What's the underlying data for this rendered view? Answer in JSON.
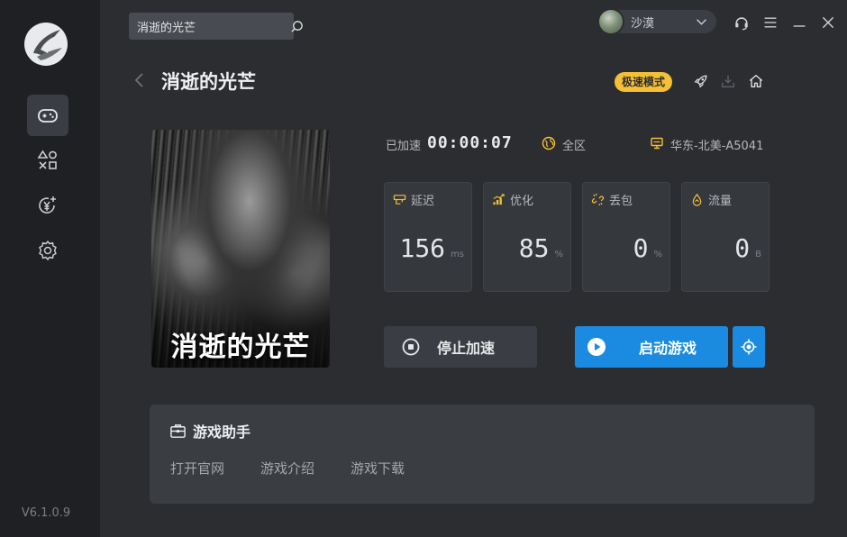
{
  "search": {
    "value": "消逝的光芒",
    "icon": "search-icon"
  },
  "user": {
    "name": "沙漠"
  },
  "topbar_icons": [
    "headset-icon",
    "menu-icon",
    "minimize-icon",
    "close-icon"
  ],
  "sidebar": {
    "items": [
      {
        "name": "games",
        "icon": "gamepad-icon",
        "active": true
      },
      {
        "name": "shapes",
        "icon": "shapes-icon",
        "active": false
      },
      {
        "name": "recharge",
        "icon": "yen-add-icon",
        "active": false
      },
      {
        "name": "settings",
        "icon": "gear-icon",
        "active": false
      }
    ],
    "version": "V6.1.0.9"
  },
  "game": {
    "title": "消逝的光芒",
    "cover_title": "消逝的光芒",
    "mode_badge": "极速模式"
  },
  "status": {
    "accelerated_label": "已加速",
    "timer": "00:00:07",
    "region": "全区",
    "server": "华东-北美-A5041"
  },
  "stats": [
    {
      "label": "延迟",
      "value": "156",
      "unit": "ms",
      "icon": "latency-icon"
    },
    {
      "label": "优化",
      "value": "85",
      "unit": "%",
      "icon": "signal-bars-icon"
    },
    {
      "label": "丢包",
      "value": "0",
      "unit": "%",
      "icon": "broken-link-icon"
    },
    {
      "label": "流量",
      "value": "0",
      "unit": "B",
      "icon": "drop-icon"
    }
  ],
  "buttons": {
    "stop": "停止加速",
    "start": "启动游戏"
  },
  "helper": {
    "title": "游戏助手",
    "links": [
      "打开官网",
      "游戏介绍",
      "游戏下载"
    ]
  },
  "colors": {
    "accent_blue": "#1a8be0",
    "badge_yellow": "#f5c034",
    "sidebar_bg": "#1e2023",
    "main_bg": "#2b2d31"
  }
}
